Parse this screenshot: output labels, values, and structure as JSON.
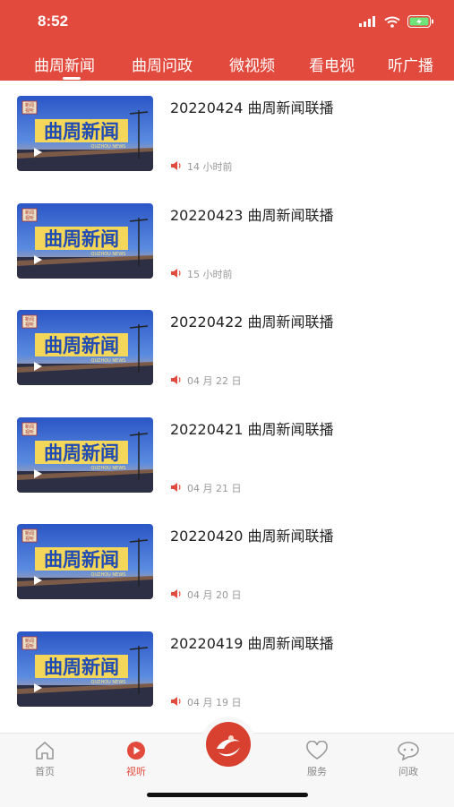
{
  "status": {
    "time": "8:52"
  },
  "tabs": [
    "曲周新闻",
    "曲周问政",
    "微视频",
    "看电视",
    "听广播"
  ],
  "thumbnail": {
    "badge": "新闻视听",
    "title": "曲周新闻",
    "subtitle": "QUZHOU NEWS"
  },
  "items": [
    {
      "title": "20220424 曲周新闻联播",
      "meta": "14 小时前"
    },
    {
      "title": "20220423 曲周新闻联播",
      "meta": "15 小时前"
    },
    {
      "title": "20220422 曲周新闻联播",
      "meta": "04 月 22 日"
    },
    {
      "title": "20220421 曲周新闻联播",
      "meta": "04 月 21 日"
    },
    {
      "title": "20220420 曲周新闻联播",
      "meta": "04 月 20 日"
    },
    {
      "title": "20220419 曲周新闻联播",
      "meta": "04 月 19 日"
    }
  ],
  "tabbar": {
    "home": "首页",
    "watch": "视听",
    "service": "服务",
    "politics": "问政"
  },
  "colors": {
    "brand": "#e24a3d",
    "inactive": "#888888"
  }
}
